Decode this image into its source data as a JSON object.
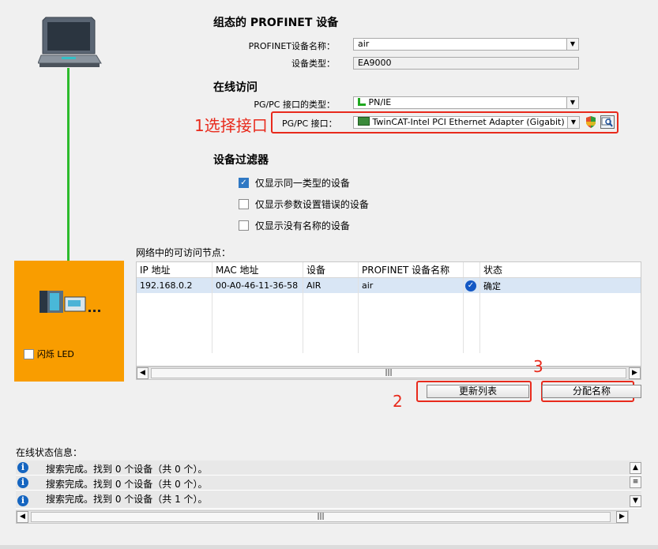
{
  "device_config": {
    "heading": "组态的 PROFINET 设备",
    "name_label": "PROFINET设备名称：",
    "name_value": "air",
    "type_label": "设备类型：",
    "type_value": "EA9000"
  },
  "online_access": {
    "heading": "在线访问",
    "iface_type_label": "PG/PC 接口的类型：",
    "iface_type_value": "PN/IE",
    "iface_label": "PG/PC 接口：",
    "iface_value": "TwinCAT-Intel PCI Ethernet Adapter (Gigabit)"
  },
  "annotations": {
    "step1": "1选择接口",
    "step2": "2",
    "step3": "3"
  },
  "filter": {
    "heading": "设备过滤器",
    "options": [
      {
        "label": "仅显示同一类型的设备",
        "checked": true
      },
      {
        "label": "仅显示参数设置错误的设备",
        "checked": false
      },
      {
        "label": "仅显示没有名称的设备",
        "checked": false
      }
    ]
  },
  "nodes": {
    "title": "网络中的可访问节点：",
    "columns": [
      "IP 地址",
      "MAC 地址",
      "设备",
      "PROFINET 设备名称",
      "状态"
    ],
    "rows": [
      {
        "ip": "192.168.0.2",
        "mac": "00-A0-46-11-36-58",
        "device": "AIR",
        "name": "air",
        "status": "确定"
      }
    ]
  },
  "device_panel": {
    "flash_led_label": "闪烁 LED"
  },
  "buttons": {
    "update_list": "更新列表",
    "assign_name": "分配名称"
  },
  "status": {
    "title": "在线状态信息：",
    "messages": [
      "搜索完成。找到 0 个设备（共 0 个）。",
      "搜索完成。找到 0 个设备（共 0 个）。",
      "搜索完成。找到 0 个设备（共 1 个）。"
    ]
  },
  "colors": {
    "device_panel_bg": "#f99d00",
    "cable": "#2dbb2d",
    "annotation_red": "#e82a1c",
    "selection_row": "#d9e6f5",
    "ok_check": "#1458c4"
  }
}
